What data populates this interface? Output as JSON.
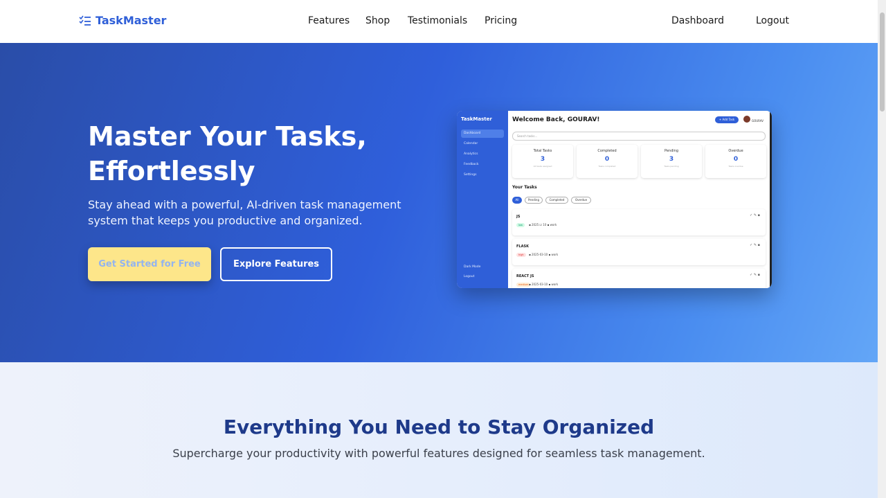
{
  "nav": {
    "brand": "TaskMaster",
    "links": [
      "Features",
      "Shop",
      "Testimonials",
      "Pricing"
    ],
    "dashboard": "Dashboard",
    "logout": "Logout"
  },
  "hero": {
    "title": "Master Your Tasks, Effortlessly",
    "subtitle": "Stay ahead with a powerful, AI-driven task management system that keeps you productive and organized.",
    "primary_cta": "Get Started for Free",
    "secondary_cta": "Explore Features"
  },
  "mockup": {
    "brand": "TaskMaster",
    "sidebar": [
      "Dashboard",
      "Calendar",
      "Analytics",
      "Feedback",
      "Settings"
    ],
    "dark_mode": "Dark Mode",
    "logout": "Logout",
    "welcome": "Welcome Back, GOURAV!",
    "add_task": "+ Add Task",
    "user": "GOURAV",
    "search_placeholder": "Search tasks...",
    "stats": [
      {
        "label": "Total Tasks",
        "value": "3",
        "sub": "All tasks assigned"
      },
      {
        "label": "Completed",
        "value": "0",
        "sub": "Tasks completed"
      },
      {
        "label": "Pending",
        "value": "3",
        "sub": "Tasks pending"
      },
      {
        "label": "Overdue",
        "value": "0",
        "sub": "Tasks overdue"
      }
    ],
    "your_tasks": "Your Tasks",
    "filters": [
      "All",
      "Pending",
      "Completed",
      "Overdue"
    ],
    "tasks": [
      {
        "name": "JS",
        "priority": "low",
        "details": "▪ 2025 ☑ 10 ▪ work"
      },
      {
        "name": "FLASK",
        "priority": "high",
        "details": "▪ 2025-03-10 ▪ work"
      },
      {
        "name": "REACT JS",
        "priority": "medium",
        "details": "▪ 2025-03-10 ▪ work"
      }
    ],
    "task_actions": "✓ ✎ ▪"
  },
  "features": {
    "title": "Everything You Need to Stay Organized",
    "subtitle": "Supercharge your productivity with powerful features designed for seamless task management."
  },
  "colors": {
    "brand": "#2f5fd8",
    "cta_yellow": "#fde68a",
    "heading_navy": "#1e3a8a"
  }
}
